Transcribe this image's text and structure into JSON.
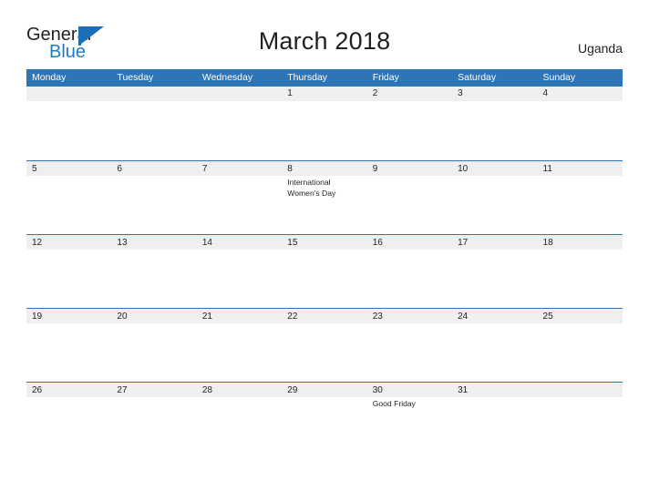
{
  "brand": {
    "name_part1": "General",
    "name_part2": "Blue",
    "triangle_color": "#1d6fb5",
    "blue_text_color": "#1d7ac8"
  },
  "header": {
    "title": "March 2018",
    "country": "Uganda"
  },
  "theme": {
    "header_blue": "#2e75b6",
    "band_gray": "#efefef",
    "rule_blue": "#2e75b6",
    "text_dark": "#231f20"
  },
  "calendar": {
    "weekdays": [
      "Monday",
      "Tuesday",
      "Wednesday",
      "Thursday",
      "Friday",
      "Saturday",
      "Sunday"
    ],
    "weeks": [
      {
        "rule": false,
        "days": [
          {
            "num": "",
            "events": []
          },
          {
            "num": "",
            "events": []
          },
          {
            "num": "",
            "events": []
          },
          {
            "num": "1",
            "events": []
          },
          {
            "num": "2",
            "events": []
          },
          {
            "num": "3",
            "events": []
          },
          {
            "num": "4",
            "events": []
          }
        ]
      },
      {
        "rule": true,
        "days": [
          {
            "num": "5",
            "events": []
          },
          {
            "num": "6",
            "events": []
          },
          {
            "num": "7",
            "events": []
          },
          {
            "num": "8",
            "events": [
              "International Women's Day"
            ]
          },
          {
            "num": "9",
            "events": []
          },
          {
            "num": "10",
            "events": []
          },
          {
            "num": "11",
            "events": []
          }
        ]
      },
      {
        "rule": true,
        "days": [
          {
            "num": "12",
            "events": []
          },
          {
            "num": "13",
            "events": []
          },
          {
            "num": "14",
            "events": []
          },
          {
            "num": "15",
            "events": []
          },
          {
            "num": "16",
            "events": []
          },
          {
            "num": "17",
            "events": []
          },
          {
            "num": "18",
            "events": []
          }
        ]
      },
      {
        "rule": true,
        "days": [
          {
            "num": "19",
            "events": []
          },
          {
            "num": "20",
            "events": []
          },
          {
            "num": "21",
            "events": []
          },
          {
            "num": "22",
            "events": []
          },
          {
            "num": "23",
            "events": []
          },
          {
            "num": "24",
            "events": []
          },
          {
            "num": "25",
            "events": []
          }
        ]
      },
      {
        "rule": true,
        "days": [
          {
            "num": "26",
            "events": []
          },
          {
            "num": "27",
            "events": []
          },
          {
            "num": "28",
            "events": []
          },
          {
            "num": "29",
            "events": []
          },
          {
            "num": "30",
            "events": [
              "Good Friday"
            ]
          },
          {
            "num": "31",
            "events": []
          },
          {
            "num": "",
            "events": []
          }
        ]
      }
    ]
  }
}
